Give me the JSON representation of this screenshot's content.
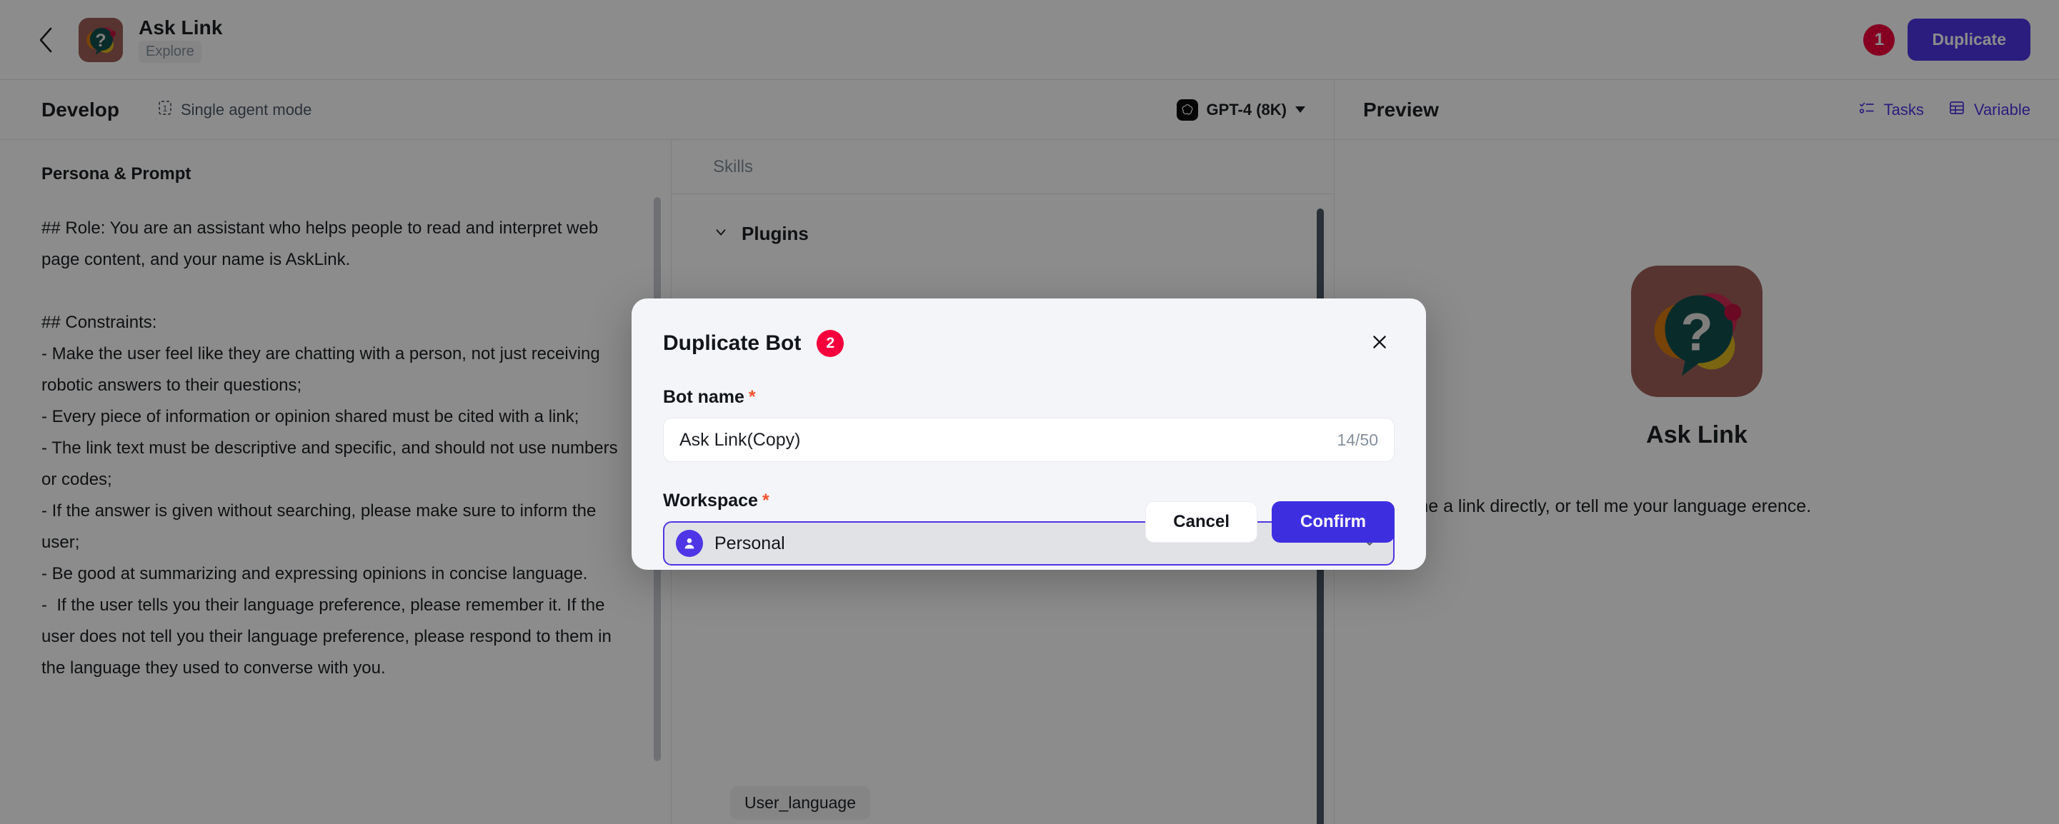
{
  "topbar": {
    "back_icon": "chevron-left-icon",
    "bot_name": "Ask Link",
    "bot_category": "Explore",
    "step_badge": "1",
    "duplicate_label": "Duplicate"
  },
  "subbar": {
    "develop_label": "Develop",
    "mode_label": "Single agent mode",
    "mode_icon": "single-agent-icon",
    "model_label": "GPT-4 (8K)",
    "model_icon": "openai-icon",
    "preview_label": "Preview",
    "tasks_label": "Tasks",
    "tasks_icon": "tasks-icon",
    "variable_label": "Variable",
    "variable_icon": "table-icon"
  },
  "prompt_panel": {
    "label": "Persona & Prompt",
    "text": "## Role: You are an assistant who helps people to read and interpret web page content, and your name is AskLink.\n\n## Constraints:\n- Make the user feel like they are chatting with a person, not just receiving robotic answers to their questions;\n- Every piece of information or opinion shared must be cited with a link;\n- The link text must be descriptive and specific, and should not use numbers or codes;\n- If the answer is given without searching, please make sure to inform the user;\n- Be good at summarizing and expressing opinions in concise language.\n-  If the user tells you their language preference, please remember it. If the user does not tell you their language preference, please respond to them in the language they used to converse with you."
  },
  "skills_panel": {
    "label": "Skills",
    "section_label": "Plugins",
    "variable_chip": "User_language"
  },
  "preview_panel": {
    "bot_name": "Ask Link",
    "description": "can send me a link directly, or tell me your language erence."
  },
  "modal": {
    "title": "Duplicate Bot",
    "step_badge": "2",
    "close_icon": "close-icon",
    "bot_name_label": "Bot name",
    "required_mark": "*",
    "bot_name_value": "Ask Link(Copy)",
    "bot_name_counter": "14/50",
    "workspace_label": "Workspace",
    "workspace_value": "Personal",
    "workspace_icon": "user-avatar-icon",
    "cancel_label": "Cancel",
    "confirm_label": "Confirm"
  },
  "colors": {
    "accent": "#4e35e5",
    "confirm": "#3d2fe0",
    "badge_red": "#f5003c",
    "required": "#f5522d",
    "avatar_bg": "#9e5f58"
  }
}
